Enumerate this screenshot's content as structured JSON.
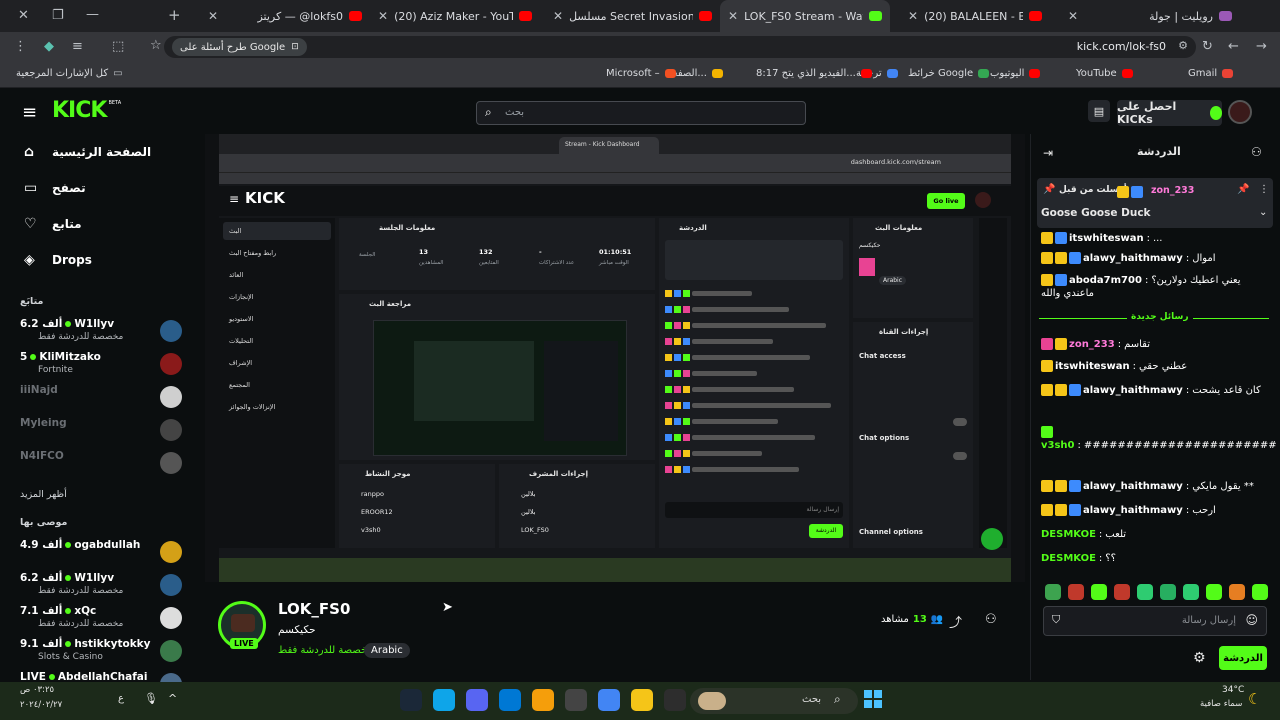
{
  "browser": {
    "tabs": [
      {
        "title": "رويليت | جولة",
        "color": "#9b59b6"
      },
      {
        "title": "(20) BALALEEN - BLVXB بلالين",
        "color": "#ff0000"
      },
      {
        "title": "LOK_FS0 Stream - Watch Li",
        "color": "#53fc18",
        "active": true
      },
      {
        "title": "مسلسل Secret Invasion الموسم",
        "color": "#ff0000"
      },
      {
        "title": "(20) Aziz Maker - YouTube",
        "color": "#ff0000"
      },
      {
        "title": "كريتز — @lokfs0",
        "color": "#ff0000"
      }
    ],
    "url": "kick.com/lok-fs0",
    "google_pill": "طرح أسئلة على Google",
    "bookmarks": [
      {
        "label": "Gmail",
        "color": "#ea4335"
      },
      {
        "label": "YouTube",
        "color": "#ff0000"
      },
      {
        "label": "اليوتيوب",
        "color": "#ff0000"
      },
      {
        "label": "خرائط Google",
        "color": "#34a853"
      },
      {
        "label": "ترجمة",
        "color": "#4285f4"
      },
      {
        "label": "8:17 الفيديو الذي يتح...",
        "color": "#ff0000"
      },
      {
        "label": "الصفحة...",
        "color": "#f4b400"
      },
      {
        "label": "Microsoft –",
        "color": "#f25022"
      }
    ],
    "bookmarks_folder": "كل الإشارات المرجعية"
  },
  "header": {
    "logo": "KICK",
    "logo_beta": "BETA",
    "search_placeholder": "بحث",
    "get_kicks": "احصل على KICKs"
  },
  "sidebar": {
    "nav": [
      {
        "label": "الصفحة الرئيسية",
        "icon": "home-icon"
      },
      {
        "label": "تصفح",
        "icon": "browse-icon"
      },
      {
        "label": "متابع",
        "icon": "heart-icon"
      },
      {
        "label": "Drops",
        "icon": "drops-icon"
      }
    ],
    "following_title": "متابَع",
    "following": [
      {
        "name": "W1llyv",
        "viewers": "6.2 ألف",
        "sub": "مخصصة للدردشة فقط",
        "live": true,
        "color": "#2a5d8a"
      },
      {
        "name": "KliMitzako",
        "viewers": "5",
        "sub": "Fortnite",
        "live": true,
        "color": "#8a1a1a"
      },
      {
        "name": "iiiNajd",
        "viewers": "",
        "sub": "",
        "live": false,
        "color": "#cfcfcf"
      },
      {
        "name": "Myleing",
        "viewers": "",
        "sub": "",
        "live": false,
        "color": "#444"
      },
      {
        "name": "N4IFCO",
        "viewers": "",
        "sub": "",
        "live": false,
        "color": "#555"
      }
    ],
    "show_more": "أظهر المزيد",
    "recommended_title": "موصى بها",
    "recommended": [
      {
        "name": "ogabdullah",
        "viewers": "4.9 ألف",
        "sub": "",
        "color": "#d4a017"
      },
      {
        "name": "W1llyv",
        "viewers": "6.2 ألف",
        "sub": "مخصصة للدردشة فقط",
        "color": "#2a5d8a"
      },
      {
        "name": "xQc",
        "viewers": "7.1 ألف",
        "sub": "مخصصة للدردشة فقط",
        "color": "#ddd"
      },
      {
        "name": "hstikkytokky",
        "viewers": "9.1 ألف",
        "sub": "Slots & Casino",
        "color": "#3a7a4a"
      },
      {
        "name": "AbdellahChafai",
        "viewers": "LIVE",
        "sub": "",
        "color": "#4a6a8a"
      }
    ]
  },
  "stream": {
    "channel": "LOK_FS0",
    "title": "حكيكسم",
    "category": "مخصصة للدردشة فقط",
    "tag": "Arabic",
    "live_label": "LIVE",
    "viewers": "13",
    "viewers_label": "مشاهد"
  },
  "inner_dashboard": {
    "url": "dashboard.kick.com/stream",
    "go_live": "Go live",
    "menu": [
      "البث",
      "رابط ومفتاح البث",
      "العائد",
      "الإنجازات",
      "الاستوديو",
      "التحليلات",
      "الإشراف",
      "المجتمع",
      "الإنزالات والجوائز"
    ],
    "session_title": "معلومات الجلسة",
    "session_stats": [
      {
        "value": "01:10:51",
        "label": "الوقت مباشر"
      },
      {
        "value": "-",
        "label": "عدد الاشتراكات"
      },
      {
        "value": "132",
        "label": "المتابعين"
      },
      {
        "value": "13",
        "label": "المشاهدين"
      },
      {
        "value": "",
        "label": "الجلسة"
      }
    ],
    "preview_title": "مراجعة البث",
    "activity_title": "موجز النشاط",
    "activity": [
      "ranppo",
      "EROOR12",
      "v3sh0"
    ],
    "mod_title": "إجراءات المشرف",
    "mod": [
      "بلالين",
      "بلالين",
      "LOK_FS0"
    ],
    "chat_title": "الدردشة",
    "info_title": "معلومات البث",
    "info_name": "حكيكسم",
    "info_tag": "Arabic",
    "actions_title": "إجراءات القناة",
    "chat_access": "Chat access",
    "chat_options": "Chat options",
    "channel_options": "Channel options",
    "chat_send": "الدردشة",
    "chat_placeholder": "إرسال رسالة"
  },
  "chat": {
    "title": "الدردشة",
    "pinned_by": "أرسلت من قبل",
    "pinned_user": "zon_233",
    "pinned_text": "Goose Goose Duck",
    "new_messages": "رسائل جديدة",
    "messages": [
      {
        "user": "itswhiteswan",
        "text": "...",
        "color": "#fff",
        "badges": [
          "#f5c518",
          "#3d8bfd"
        ]
      },
      {
        "user": "alawy_haithmawy",
        "text": "اموال",
        "color": "#fff",
        "badges": [
          "#f5c518",
          "#f5c518",
          "#3d8bfd"
        ]
      },
      {
        "user": "aboda7m700",
        "text": "يعني اعطيك دولارين؟ ماعندي والله",
        "color": "#fff",
        "badges": [
          "#f5c518",
          "#3d8bfd"
        ]
      },
      {
        "user": "zon_233",
        "text": "تقاسم",
        "color": "#ff7ad9",
        "badges": [
          "#e84393",
          "#f5c518"
        ]
      },
      {
        "user": "itswhiteswan",
        "text": "عطني حقي",
        "color": "#fff",
        "badges": [
          "#f5c518"
        ]
      },
      {
        "user": "alawy_haithmawy",
        "text": "كان قاعد يشحت",
        "color": "#fff",
        "badges": [
          "#f5c518",
          "#f5c518",
          "#3d8bfd"
        ]
      },
      {
        "user": "v3sh0",
        "text": "#######################",
        "color": "#53fc18",
        "badges": [
          "#53fc18"
        ]
      },
      {
        "user": "alawy_haithmawy",
        "text": "يقول مايكي **",
        "color": "#fff",
        "badges": [
          "#f5c518",
          "#f5c518",
          "#3d8bfd"
        ]
      },
      {
        "user": "alawy_haithmawy",
        "text": "ارحب",
        "color": "#fff",
        "badges": [
          "#f5c518",
          "#f5c518",
          "#3d8bfd"
        ]
      },
      {
        "user": "DESMKOE",
        "text": "تلعب",
        "color": "#53fc18",
        "badges": []
      },
      {
        "user": "DESMKOE",
        "text": "؟؟",
        "color": "#53fc18",
        "badges": []
      }
    ],
    "input_placeholder": "إرسال رسالة",
    "send_label": "الدردشة"
  },
  "taskbar": {
    "search": "بحث",
    "weather_temp": "34°C",
    "weather_text": "سماء صافية",
    "time": "٠٣:٢٥ ص",
    "date": "٢٠٢٤/٠٢/٢٧",
    "lang": "ع"
  }
}
